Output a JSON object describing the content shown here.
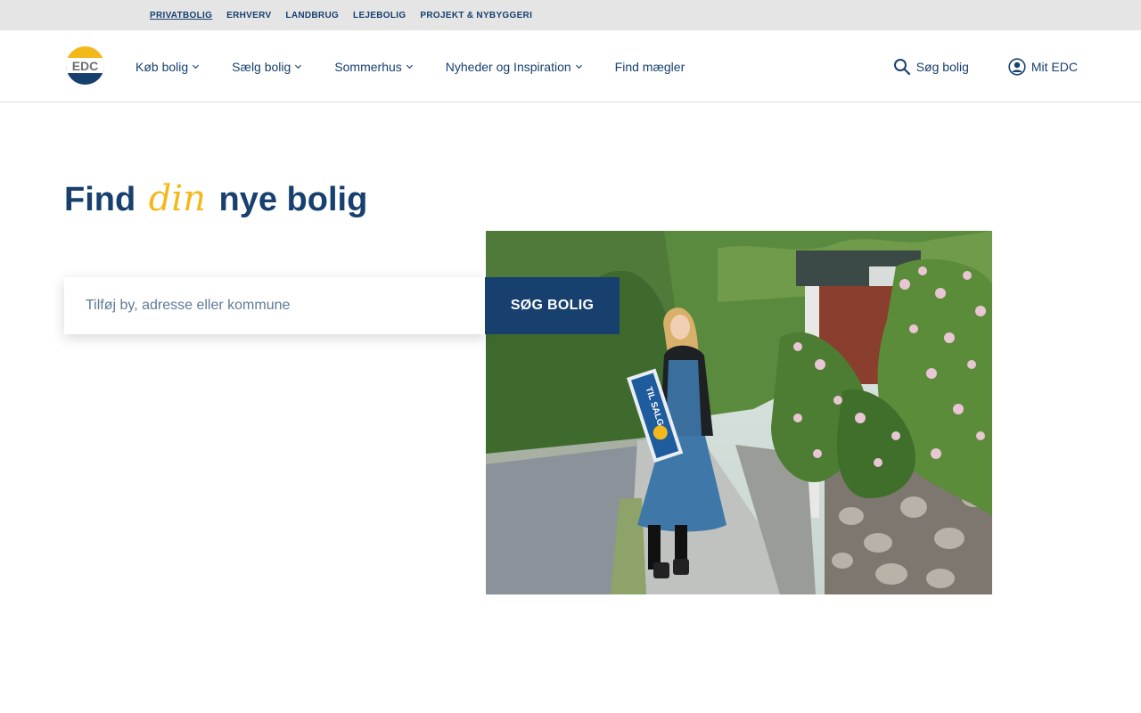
{
  "topbar": {
    "links": [
      {
        "label": "PRIVATBOLIG",
        "active": true
      },
      {
        "label": "ERHVERV",
        "active": false
      },
      {
        "label": "LANDBRUG",
        "active": false
      },
      {
        "label": "LEJEBOLIG",
        "active": false
      },
      {
        "label": "PROJEKT & NYBYGGERI",
        "active": false
      }
    ]
  },
  "header": {
    "logo_text": "EDC",
    "nav": [
      {
        "label": "Køb bolig",
        "has_dropdown": true
      },
      {
        "label": "Sælg bolig",
        "has_dropdown": true
      },
      {
        "label": "Sommerhus",
        "has_dropdown": true
      },
      {
        "label": "Nyheder og Inspiration",
        "has_dropdown": true
      },
      {
        "label": "Find mægler",
        "has_dropdown": false
      }
    ],
    "search_label": "Søg bolig",
    "account_label": "Mit EDC"
  },
  "hero": {
    "title_before": "Find",
    "title_accent": "din",
    "title_after": "nye bolig",
    "search_placeholder": "Tilføj by, adresse eller kommune",
    "search_value": "",
    "search_button": "SØG BOLIG",
    "image_sign_text": "TIL SALG"
  },
  "colors": {
    "brand_blue": "#17406f",
    "accent_yellow": "#f3b91b",
    "topbar_bg": "#e5e5e5"
  }
}
